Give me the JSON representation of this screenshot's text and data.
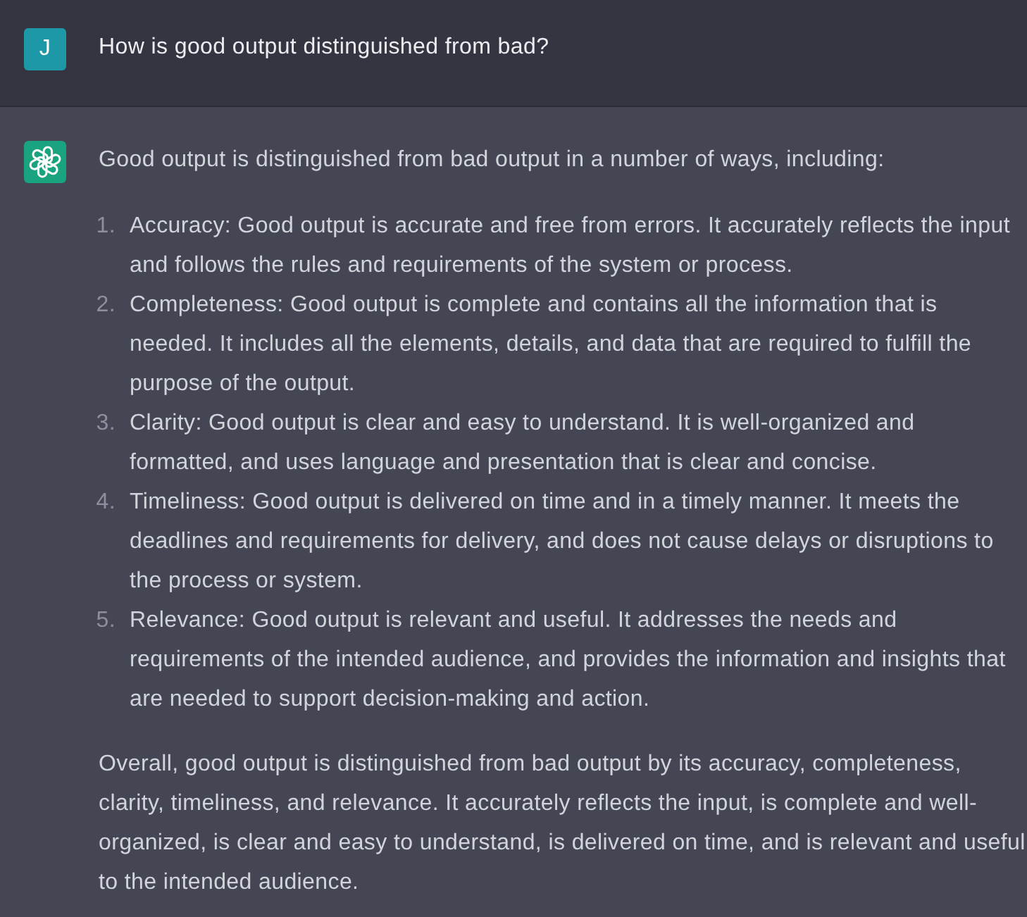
{
  "messages": [
    {
      "kind": "user",
      "avatar_letter": "J",
      "text": "How is good output distinguished from bad?"
    },
    {
      "kind": "assistant",
      "intro": "Good output is distinguished from bad output in a number of ways, including:",
      "list": [
        {
          "number": "1.",
          "text": "Accuracy: Good output is accurate and free from errors. It accurately reflects the input and follows the rules and requirements of the system or process."
        },
        {
          "number": "2.",
          "text": "Completeness: Good output is complete and contains all the information that is needed. It includes all the elements, details, and data that are required to fulfill the purpose of the output."
        },
        {
          "number": "3.",
          "text": "Clarity: Good output is clear and easy to understand. It is well-organized and formatted, and uses language and presentation that is clear and concise."
        },
        {
          "number": "4.",
          "text": "Timeliness: Good output is delivered on time and in a timely manner. It meets the deadlines and requirements for delivery, and does not cause delays or disruptions to the process or system."
        },
        {
          "number": "5.",
          "text": "Relevance: Good output is relevant and useful. It addresses the needs and requirements of the intended audience, and provides the information and insights that are needed to support decision-making and action."
        }
      ],
      "conclusion": "Overall, good output is distinguished from bad output by its accuracy, completeness, clarity, timeliness, and relevance. It accurately reflects the input, is complete and well-organized, is clear and easy to understand, is delivered on time, and is relevant and useful to the intended audience."
    }
  ]
}
